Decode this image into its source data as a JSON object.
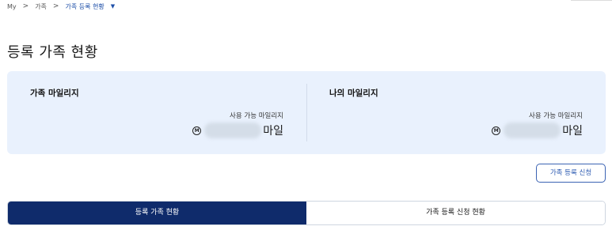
{
  "breadcrumb": {
    "items": [
      "My",
      "가족",
      "가족 등록 현황"
    ],
    "separator": ">"
  },
  "page_title": "등록 가족 현황",
  "family_mileage": {
    "title": "가족 마일리지",
    "sub_label": "사용 가능 마일리지",
    "unit": "마일"
  },
  "my_mileage": {
    "title": "나의 마일리지",
    "sub_label": "사용 가능 마일리지",
    "unit": "마일"
  },
  "mileage_icon_glyph": "M",
  "apply_button": "가족 등록 신청",
  "tabs": [
    {
      "label": "등록 가족 현황",
      "active": true
    },
    {
      "label": "가족 등록 신청 현황",
      "active": false
    }
  ],
  "colors": {
    "accent": "#0f2b6b",
    "panel_bg": "#e9f1fd",
    "link": "#1e4fa8"
  }
}
